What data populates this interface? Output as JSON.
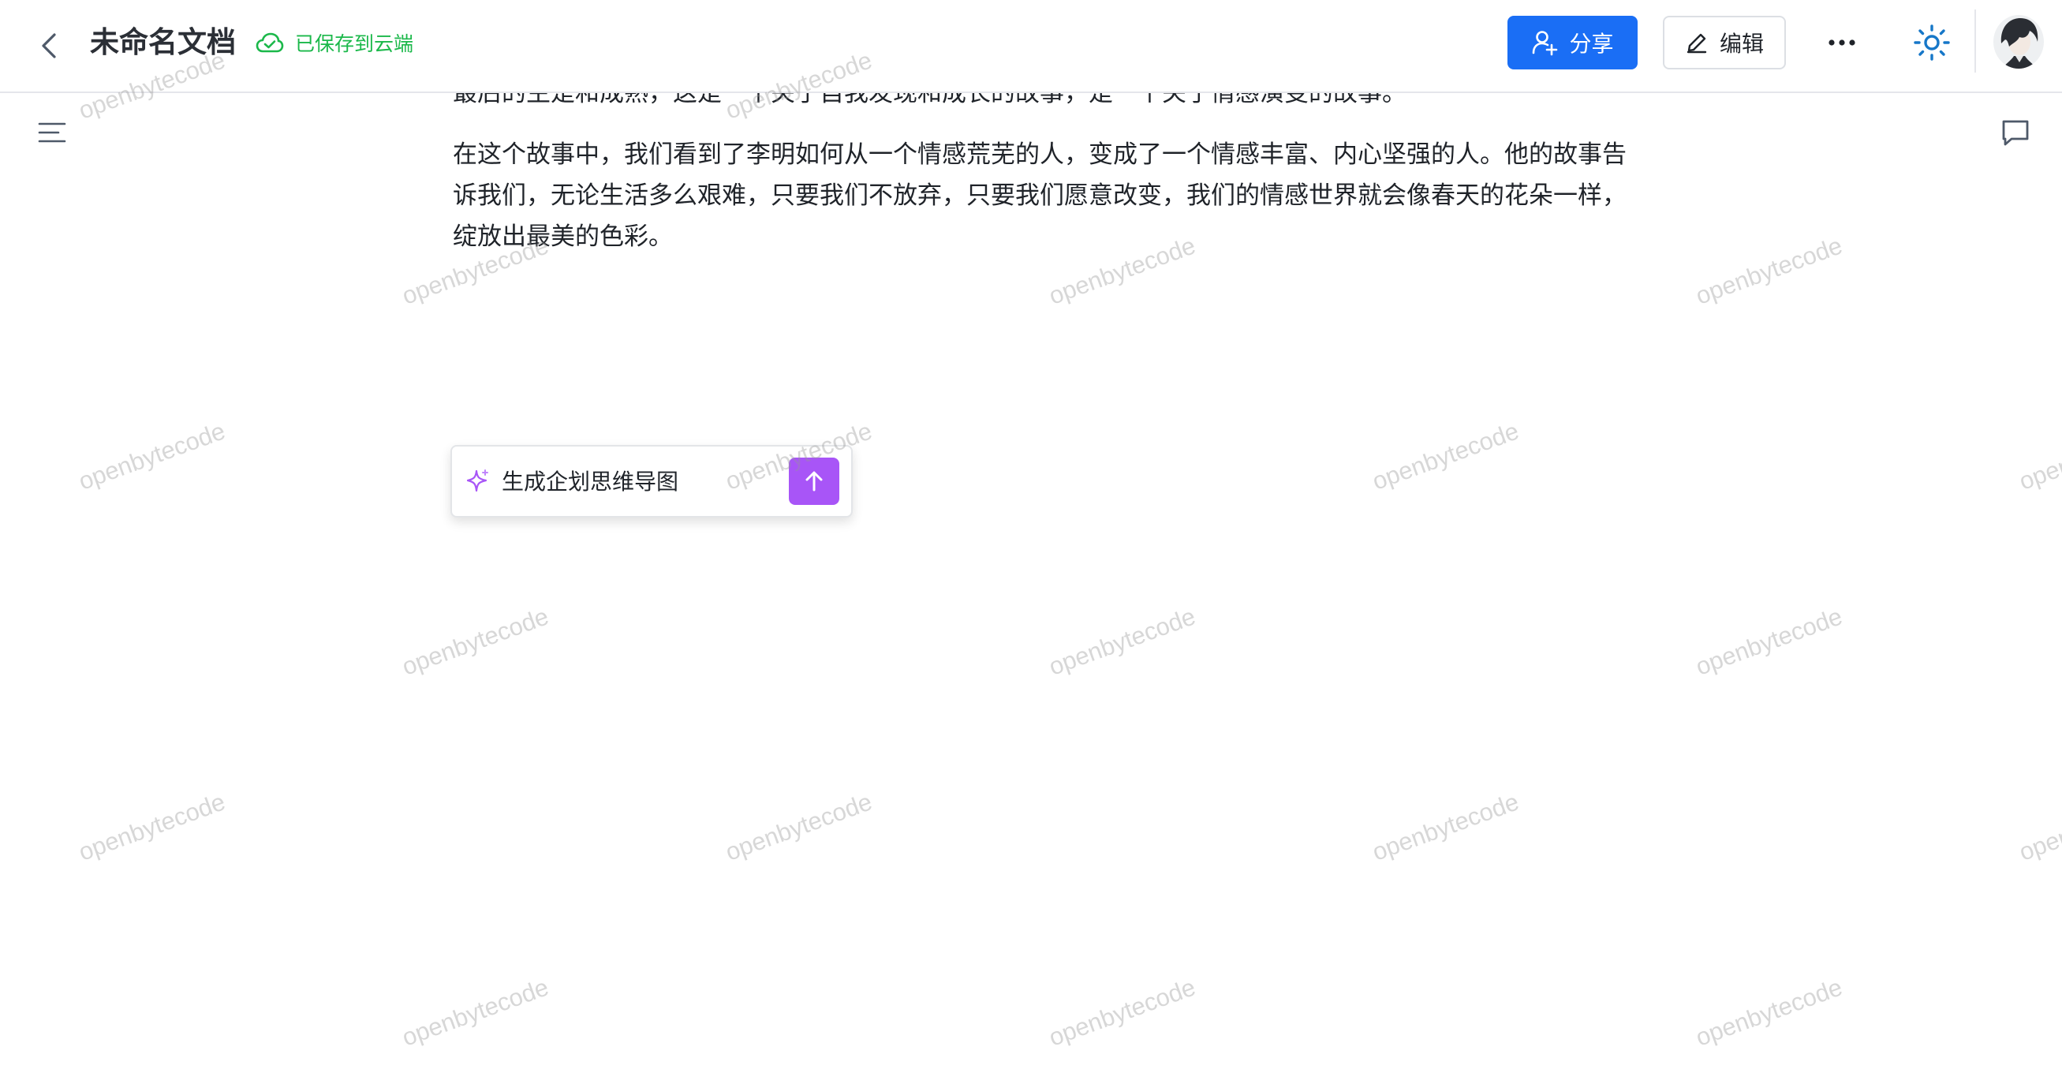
{
  "header": {
    "title": "未命名文档",
    "save_status": "已保存到云端",
    "share_label": "分享",
    "edit_label": "编辑"
  },
  "document": {
    "clipped_paragraph": "最后的主是和成熟，这是一个关于自我发现和成长的故事，是一个关于情感演变的故事。",
    "paragraph": "在这个故事中，我们看到了李明如何从一个情感荒芜的人，变成了一个情感丰富、内心坚强的人。他的故事告诉我们，无论生活多么艰难，只要我们不放弃，只要我们愿意改变，我们的情感世界就会像春天的花朵一样，绽放出最美的色彩。"
  },
  "ai_prompt": {
    "value": "生成企划思维导图"
  },
  "watermark": {
    "text": "openbytecode"
  },
  "colors": {
    "primary": "#1a6ef5",
    "saved_green": "#1bb84a",
    "ai_purple": "#a855f7",
    "theme_icon": "#1677c8"
  },
  "icons": {
    "back": "chevron-left-icon",
    "save": "cloud-check-icon",
    "share": "user-plus-icon",
    "edit": "pencil-icon",
    "more": "ellipsis-icon",
    "theme": "sun-icon",
    "outline": "list-icon",
    "comment": "comment-icon",
    "ai": "sparkle-icon",
    "send": "arrow-up-icon"
  }
}
